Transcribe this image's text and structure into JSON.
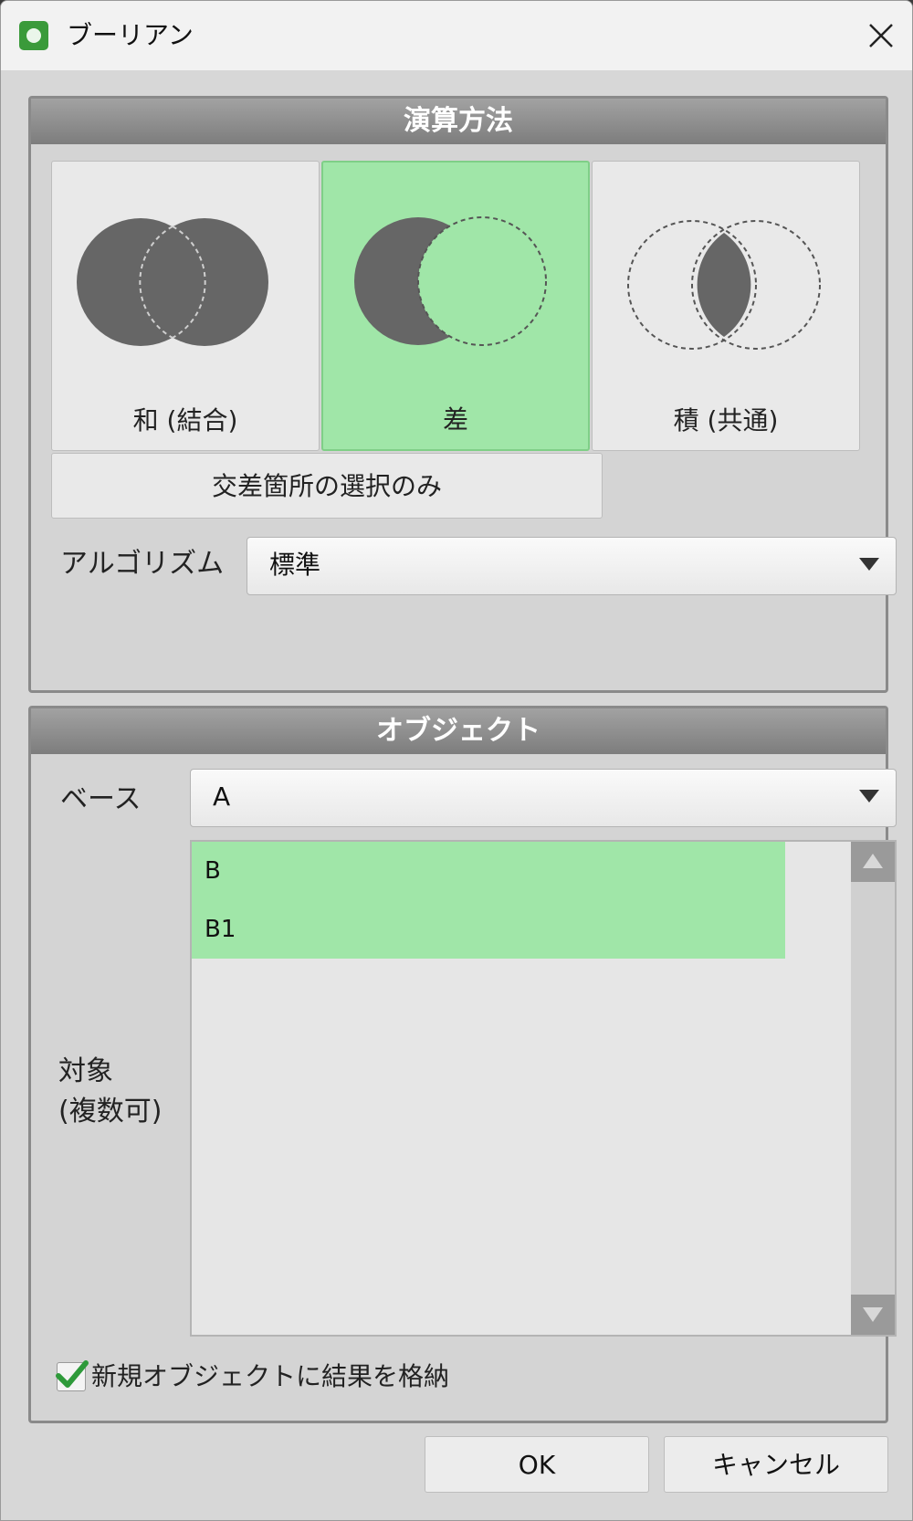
{
  "window": {
    "title": "ブーリアン"
  },
  "operation": {
    "header": "演算方法",
    "options": [
      {
        "label": "和 (結合)",
        "icon": "union-icon",
        "selected": false
      },
      {
        "label": "差",
        "icon": "difference-icon",
        "selected": true
      },
      {
        "label": "積 (共通)",
        "icon": "intersection-icon",
        "selected": false
      }
    ],
    "intersect_select_label": "交差箇所の選択のみ",
    "algorithm_label": "アルゴリズム",
    "algorithm_value": "標準"
  },
  "object": {
    "header": "オブジェクト",
    "base_label": "ベース",
    "base_value": "A",
    "target_label_line1": "対象",
    "target_label_line2": "(複数可)",
    "target_items": [
      "B",
      "B1"
    ],
    "store_new_label": "新規オブジェクトに結果を格納",
    "store_new_checked": true
  },
  "buttons": {
    "ok": "OK",
    "cancel": "キャンセル"
  },
  "colors": {
    "selected_green": "#a0e6a8",
    "check_green": "#2e9a3a",
    "shape_dark": "#666666"
  }
}
